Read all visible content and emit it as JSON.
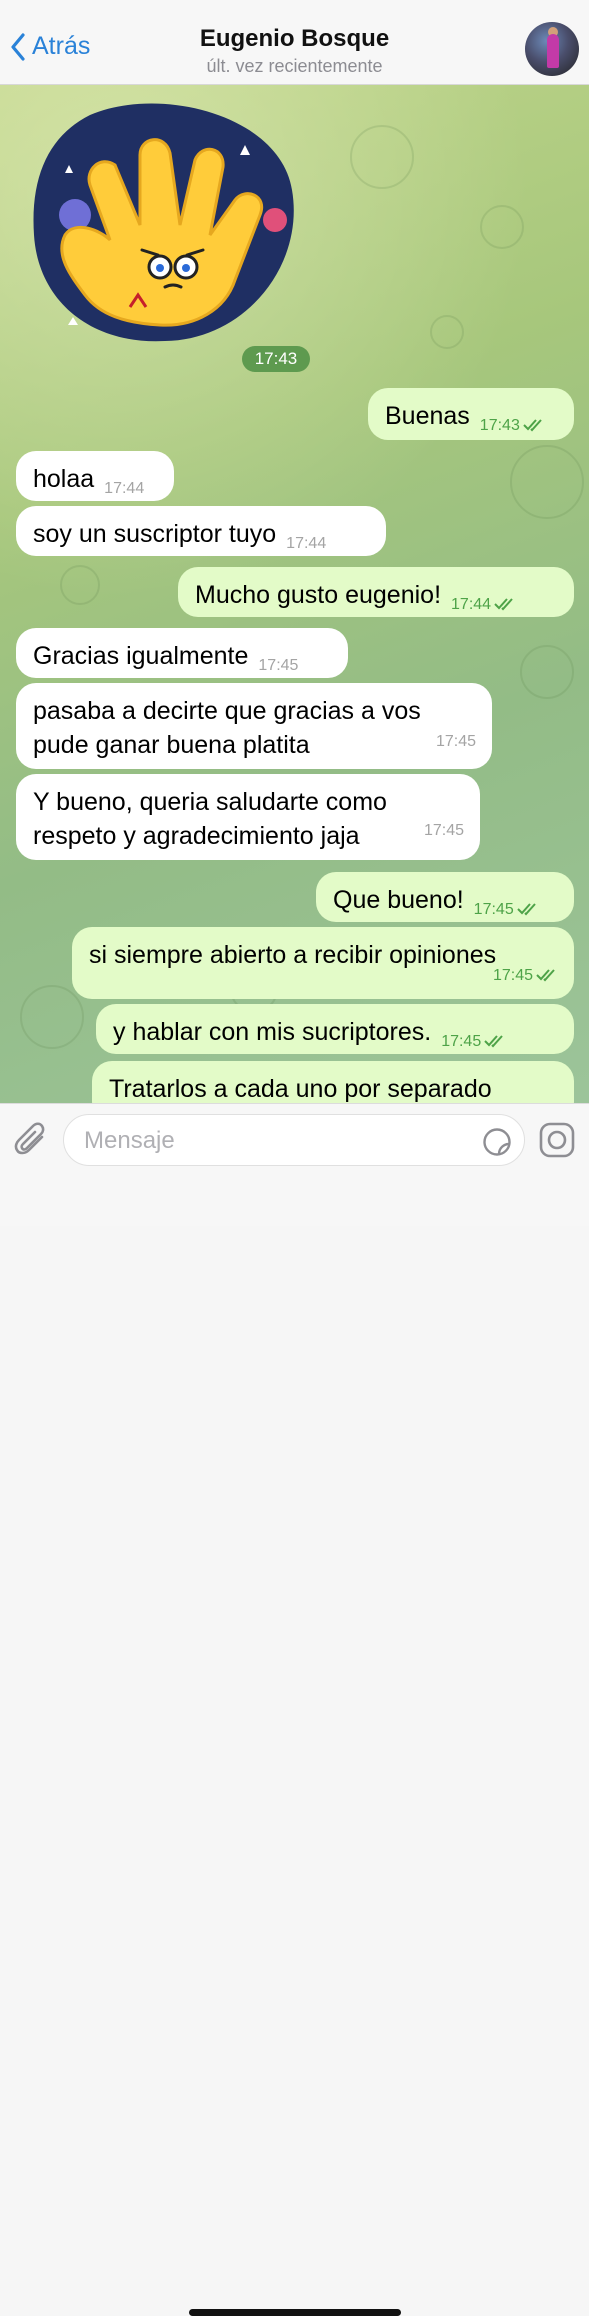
{
  "header": {
    "back_label": "Atrás",
    "contact_name": "Eugenio Bosque",
    "status": "últ. vez recientemente"
  },
  "sticker": {
    "time": "17:43",
    "icon": "spock-hand-sticker"
  },
  "messages": [
    {
      "dir": "out",
      "text": "Buenas",
      "time": "17:43",
      "read": true
    },
    {
      "dir": "in",
      "text": "holaa",
      "time": "17:44"
    },
    {
      "dir": "in",
      "text": "soy un suscriptor tuyo",
      "time": "17:44"
    },
    {
      "dir": "out",
      "text": "Mucho gusto eugenio!",
      "time": "17:44",
      "read": true
    },
    {
      "dir": "in",
      "text": "Gracias igualmente",
      "time": "17:45"
    },
    {
      "dir": "in",
      "text": "pasaba a decirte que gracias a vos pude ganar buena platita",
      "line1": "pasaba a decirte que gracias a vos",
      "line2": "pude ganar buena platita",
      "time": "17:45"
    },
    {
      "dir": "in",
      "text": "Y bueno, queria saludarte como respeto y agradecimiento jaja",
      "line1": "Y bueno, queria saludarte como",
      "line2": "respeto y agradecimiento jaja",
      "time": "17:45"
    },
    {
      "dir": "out",
      "text": "Que bueno!",
      "time": "17:45",
      "read": true
    },
    {
      "dir": "out",
      "text": "si siempre abierto a recibir opiniones",
      "time": "17:45",
      "read": true
    },
    {
      "dir": "out",
      "text": "y hablar con mis sucriptores.",
      "time": "17:45",
      "read": true
    },
    {
      "dir": "out",
      "text": "Tratarlos a cada uno por separado",
      "time": "",
      "read": false
    }
  ],
  "input": {
    "placeholder": "Mensaje"
  },
  "colors": {
    "accent": "#2a82d8",
    "outgoing_bubble": "#e3fbc8",
    "incoming_bubble": "#ffffff",
    "read_time": "#4ea348"
  }
}
